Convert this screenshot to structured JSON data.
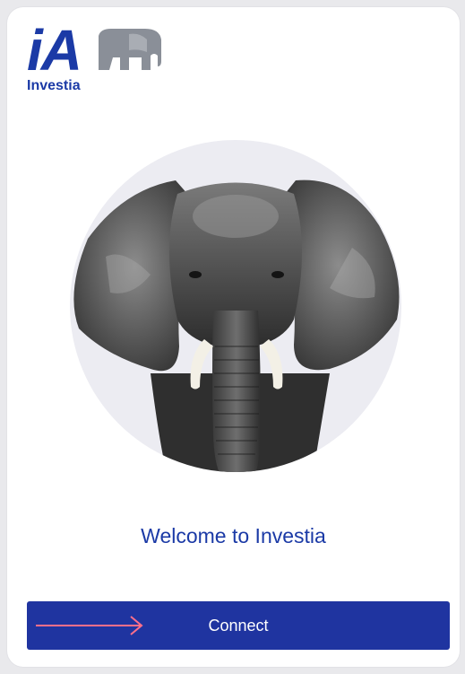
{
  "logo": {
    "mark_text": "iA",
    "brand_name": "Investia",
    "icon": "elephant-logo-icon"
  },
  "hero": {
    "icon": "elephant-photo"
  },
  "welcome": {
    "text": "Welcome to Investia"
  },
  "connect_button": {
    "label": "Connect",
    "icon": "arrow-right-icon"
  },
  "colors": {
    "brand_blue": "#1b3aa6",
    "button_blue": "#1f34a0",
    "arrow_pink": "#ff6f8a",
    "circle_bg": "#ececf2"
  }
}
